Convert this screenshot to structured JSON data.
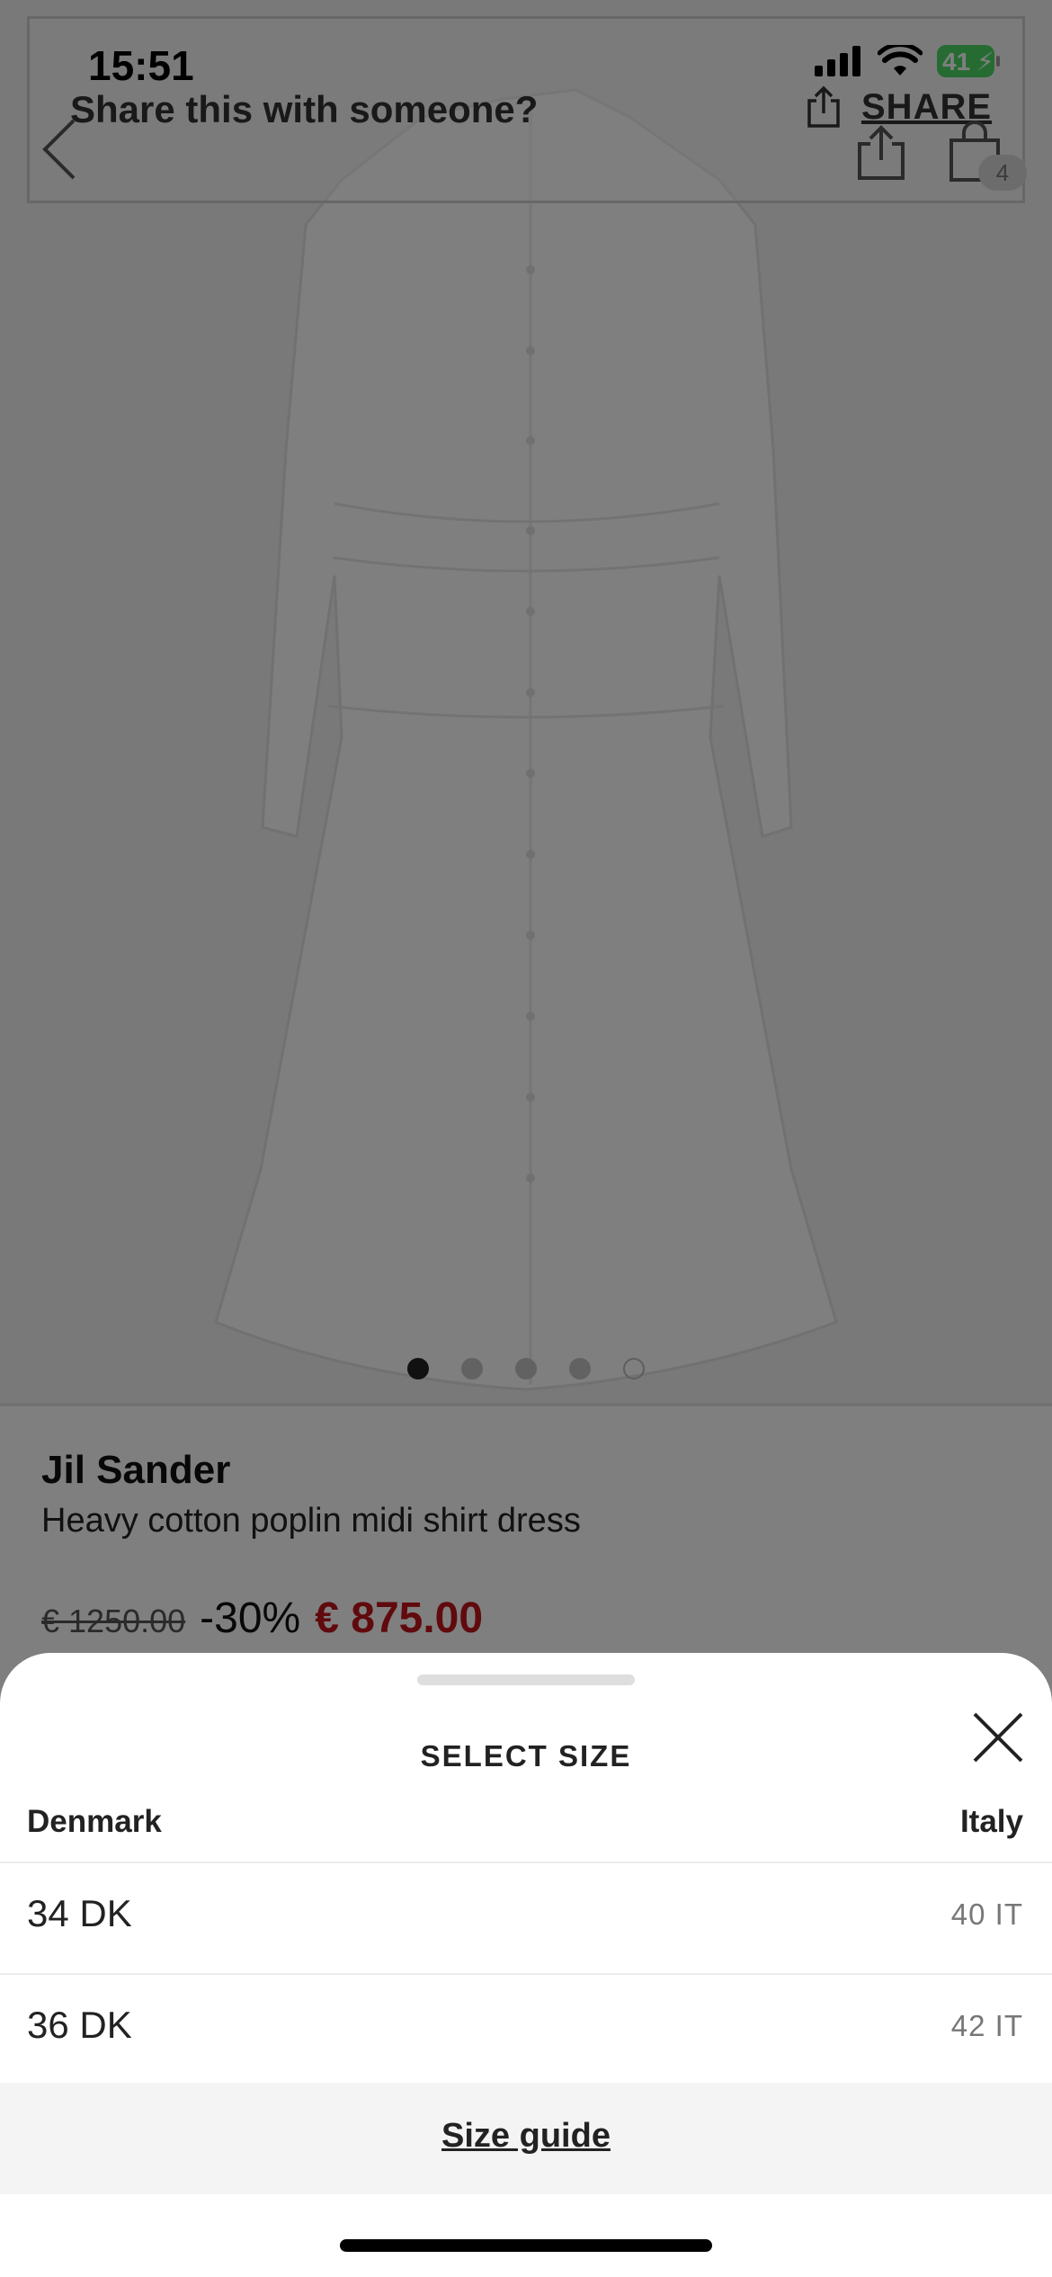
{
  "status_bar": {
    "time": "15:51",
    "battery": "41",
    "icons": [
      "signal-icon",
      "wifi-icon",
      "battery-charging-icon"
    ]
  },
  "share_banner": {
    "prompt": "Share this with someone?",
    "action_label": "SHARE"
  },
  "header": {
    "bag_count": "4",
    "icons": [
      "back-chevron-icon",
      "share-icon",
      "bag-icon"
    ]
  },
  "product": {
    "brand": "Jil Sander",
    "name": "Heavy cotton poplin midi shirt dress",
    "original_price": "€ 1250.00",
    "discount": "-30%",
    "sale_price": "€ 875.00",
    "image_count": 5,
    "active_image_index": 0
  },
  "size_sheet": {
    "title": "SELECT SIZE",
    "column_left": "Denmark",
    "column_right": "Italy",
    "sizes": [
      {
        "primary": "34 DK",
        "secondary": "40 IT"
      },
      {
        "primary": "36 DK",
        "secondary": "42 IT"
      }
    ],
    "size_guide_label": "Size guide"
  },
  "colors": {
    "sale_red": "#c0151b",
    "overlay": "rgba(0,0,0,0.5)",
    "sheet_background": "#ffffff",
    "guide_background": "#f4f4f4"
  }
}
